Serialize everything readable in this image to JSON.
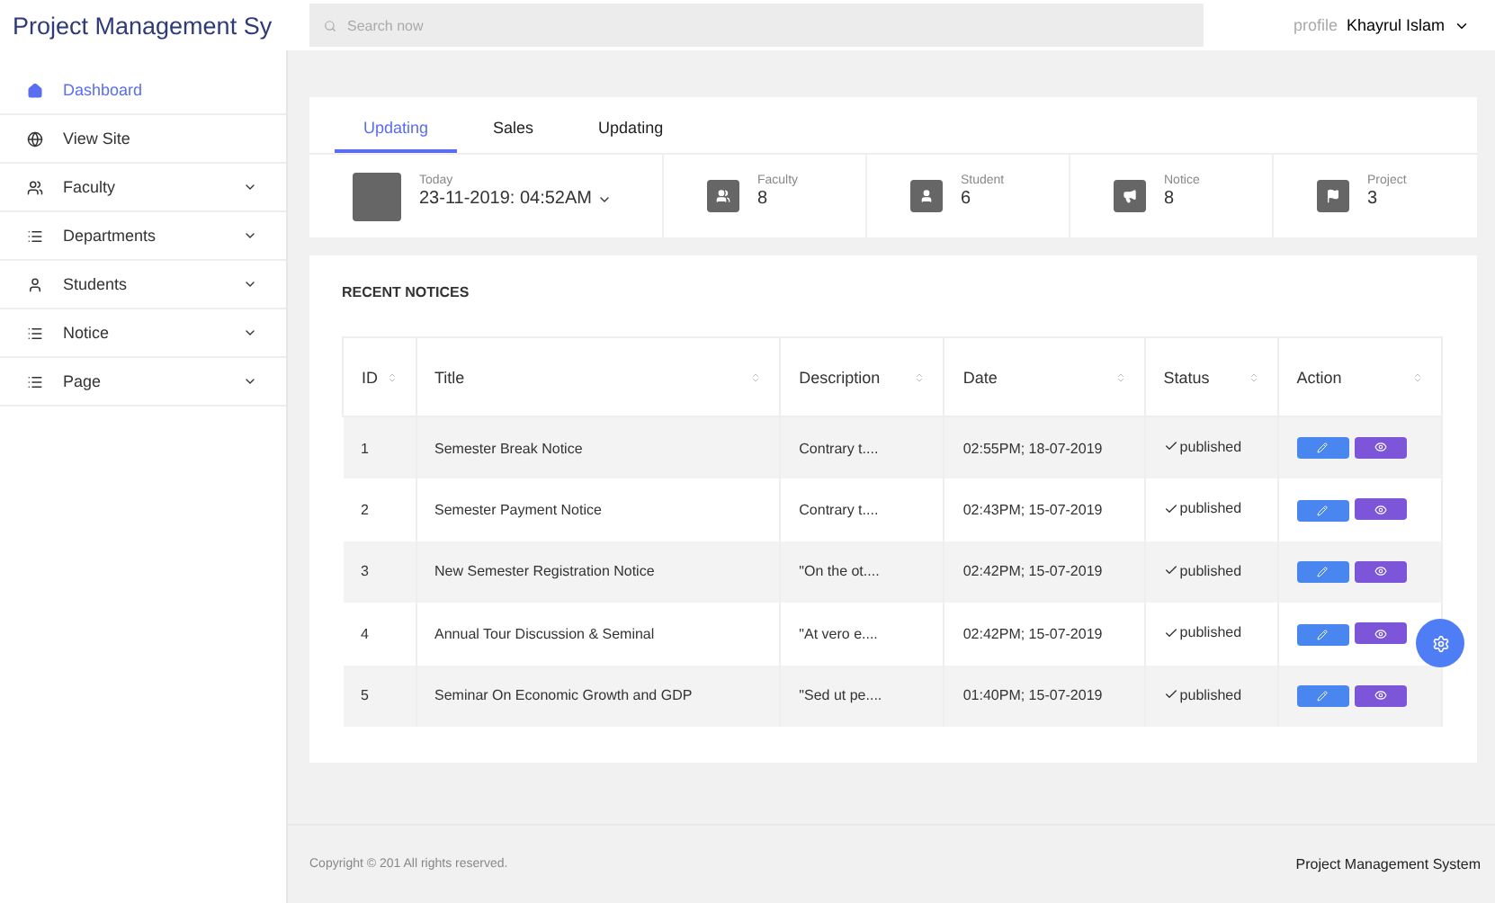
{
  "brand": "Project Management Sy",
  "search": {
    "placeholder": "Search now"
  },
  "profile": {
    "label": "profile",
    "name": "Khayrul Islam"
  },
  "sidebar": {
    "items": [
      {
        "label": "Dashboard",
        "selected": true,
        "expandable": false
      },
      {
        "label": "View Site",
        "selected": false,
        "expandable": false
      },
      {
        "label": "Faculty",
        "selected": false,
        "expandable": true
      },
      {
        "label": "Departments",
        "selected": false,
        "expandable": true
      },
      {
        "label": "Students",
        "selected": false,
        "expandable": true
      },
      {
        "label": "Notice",
        "selected": false,
        "expandable": true
      },
      {
        "label": "Page",
        "selected": false,
        "expandable": true
      }
    ]
  },
  "tabs": [
    {
      "label": "Updating",
      "selected": true
    },
    {
      "label": "Sales",
      "selected": false
    },
    {
      "label": "Updating",
      "selected": false
    }
  ],
  "today": {
    "label": "Today",
    "value": "23-11-2019: 04:52AM"
  },
  "stats": [
    {
      "label": "Faculty",
      "value": "8"
    },
    {
      "label": "Student",
      "value": "6"
    },
    {
      "label": "Notice",
      "value": "8"
    },
    {
      "label": "Project",
      "value": "3"
    }
  ],
  "notices": {
    "title": "RECENT NOTICES",
    "columns": [
      "ID",
      "Title",
      "Description",
      "Date",
      "Status",
      "Action"
    ],
    "rows": [
      {
        "id": "1",
        "title": "Semester Break Notice",
        "description": "Contrary t....",
        "date": "02:55PM; 18-07-2019",
        "status": "published"
      },
      {
        "id": "2",
        "title": "Semester Payment Notice",
        "description": "Contrary t....",
        "date": "02:43PM; 15-07-2019",
        "status": "published"
      },
      {
        "id": "3",
        "title": "New Semester Registration Notice",
        "description": "\"On the ot....",
        "date": "02:42PM; 15-07-2019",
        "status": "published"
      },
      {
        "id": "4",
        "title": "Annual Tour Discussion & Seminal",
        "description": "\"At vero e....",
        "date": "02:42PM; 15-07-2019",
        "status": "published"
      },
      {
        "id": "5",
        "title": "Seminar On Economic Growth and GDP",
        "description": "\"Sed ut pe....",
        "date": "01:40PM; 15-07-2019",
        "status": "published"
      }
    ]
  },
  "footer": {
    "copyright": "Copyright © 201   All rights reserved.",
    "brand": "Project Management System"
  }
}
